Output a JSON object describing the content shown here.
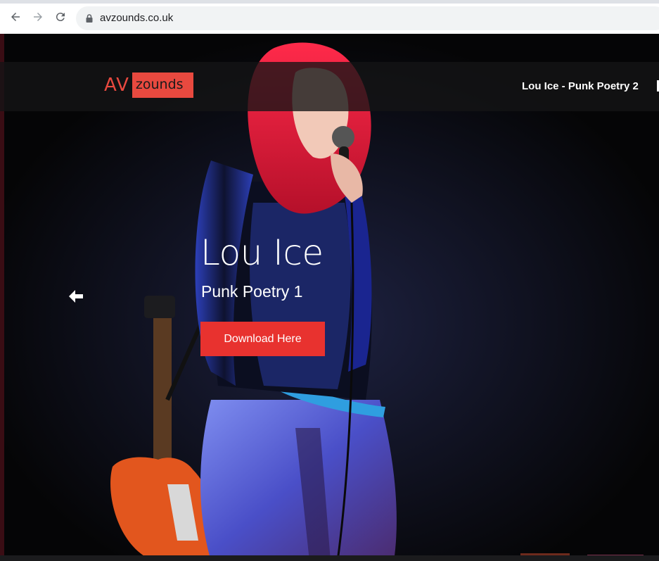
{
  "browser": {
    "url": "avzounds.co.uk",
    "back_icon": "arrow-left-icon",
    "forward_icon": "arrow-right-icon",
    "reload_icon": "reload-icon",
    "lock_icon": "lock-icon"
  },
  "site": {
    "logo": {
      "av": "AV",
      "zounds": "zounds"
    },
    "nav": {
      "current_link": "Lou Ice - Punk Poetry 2"
    },
    "brand_color": "#e8493f"
  },
  "hero": {
    "title": "Lou Ice",
    "subtitle": "Punk Poetry 1",
    "cta_label": "Download Here",
    "cta_color": "#e8322f",
    "prev_icon": "arrow-left-icon"
  }
}
